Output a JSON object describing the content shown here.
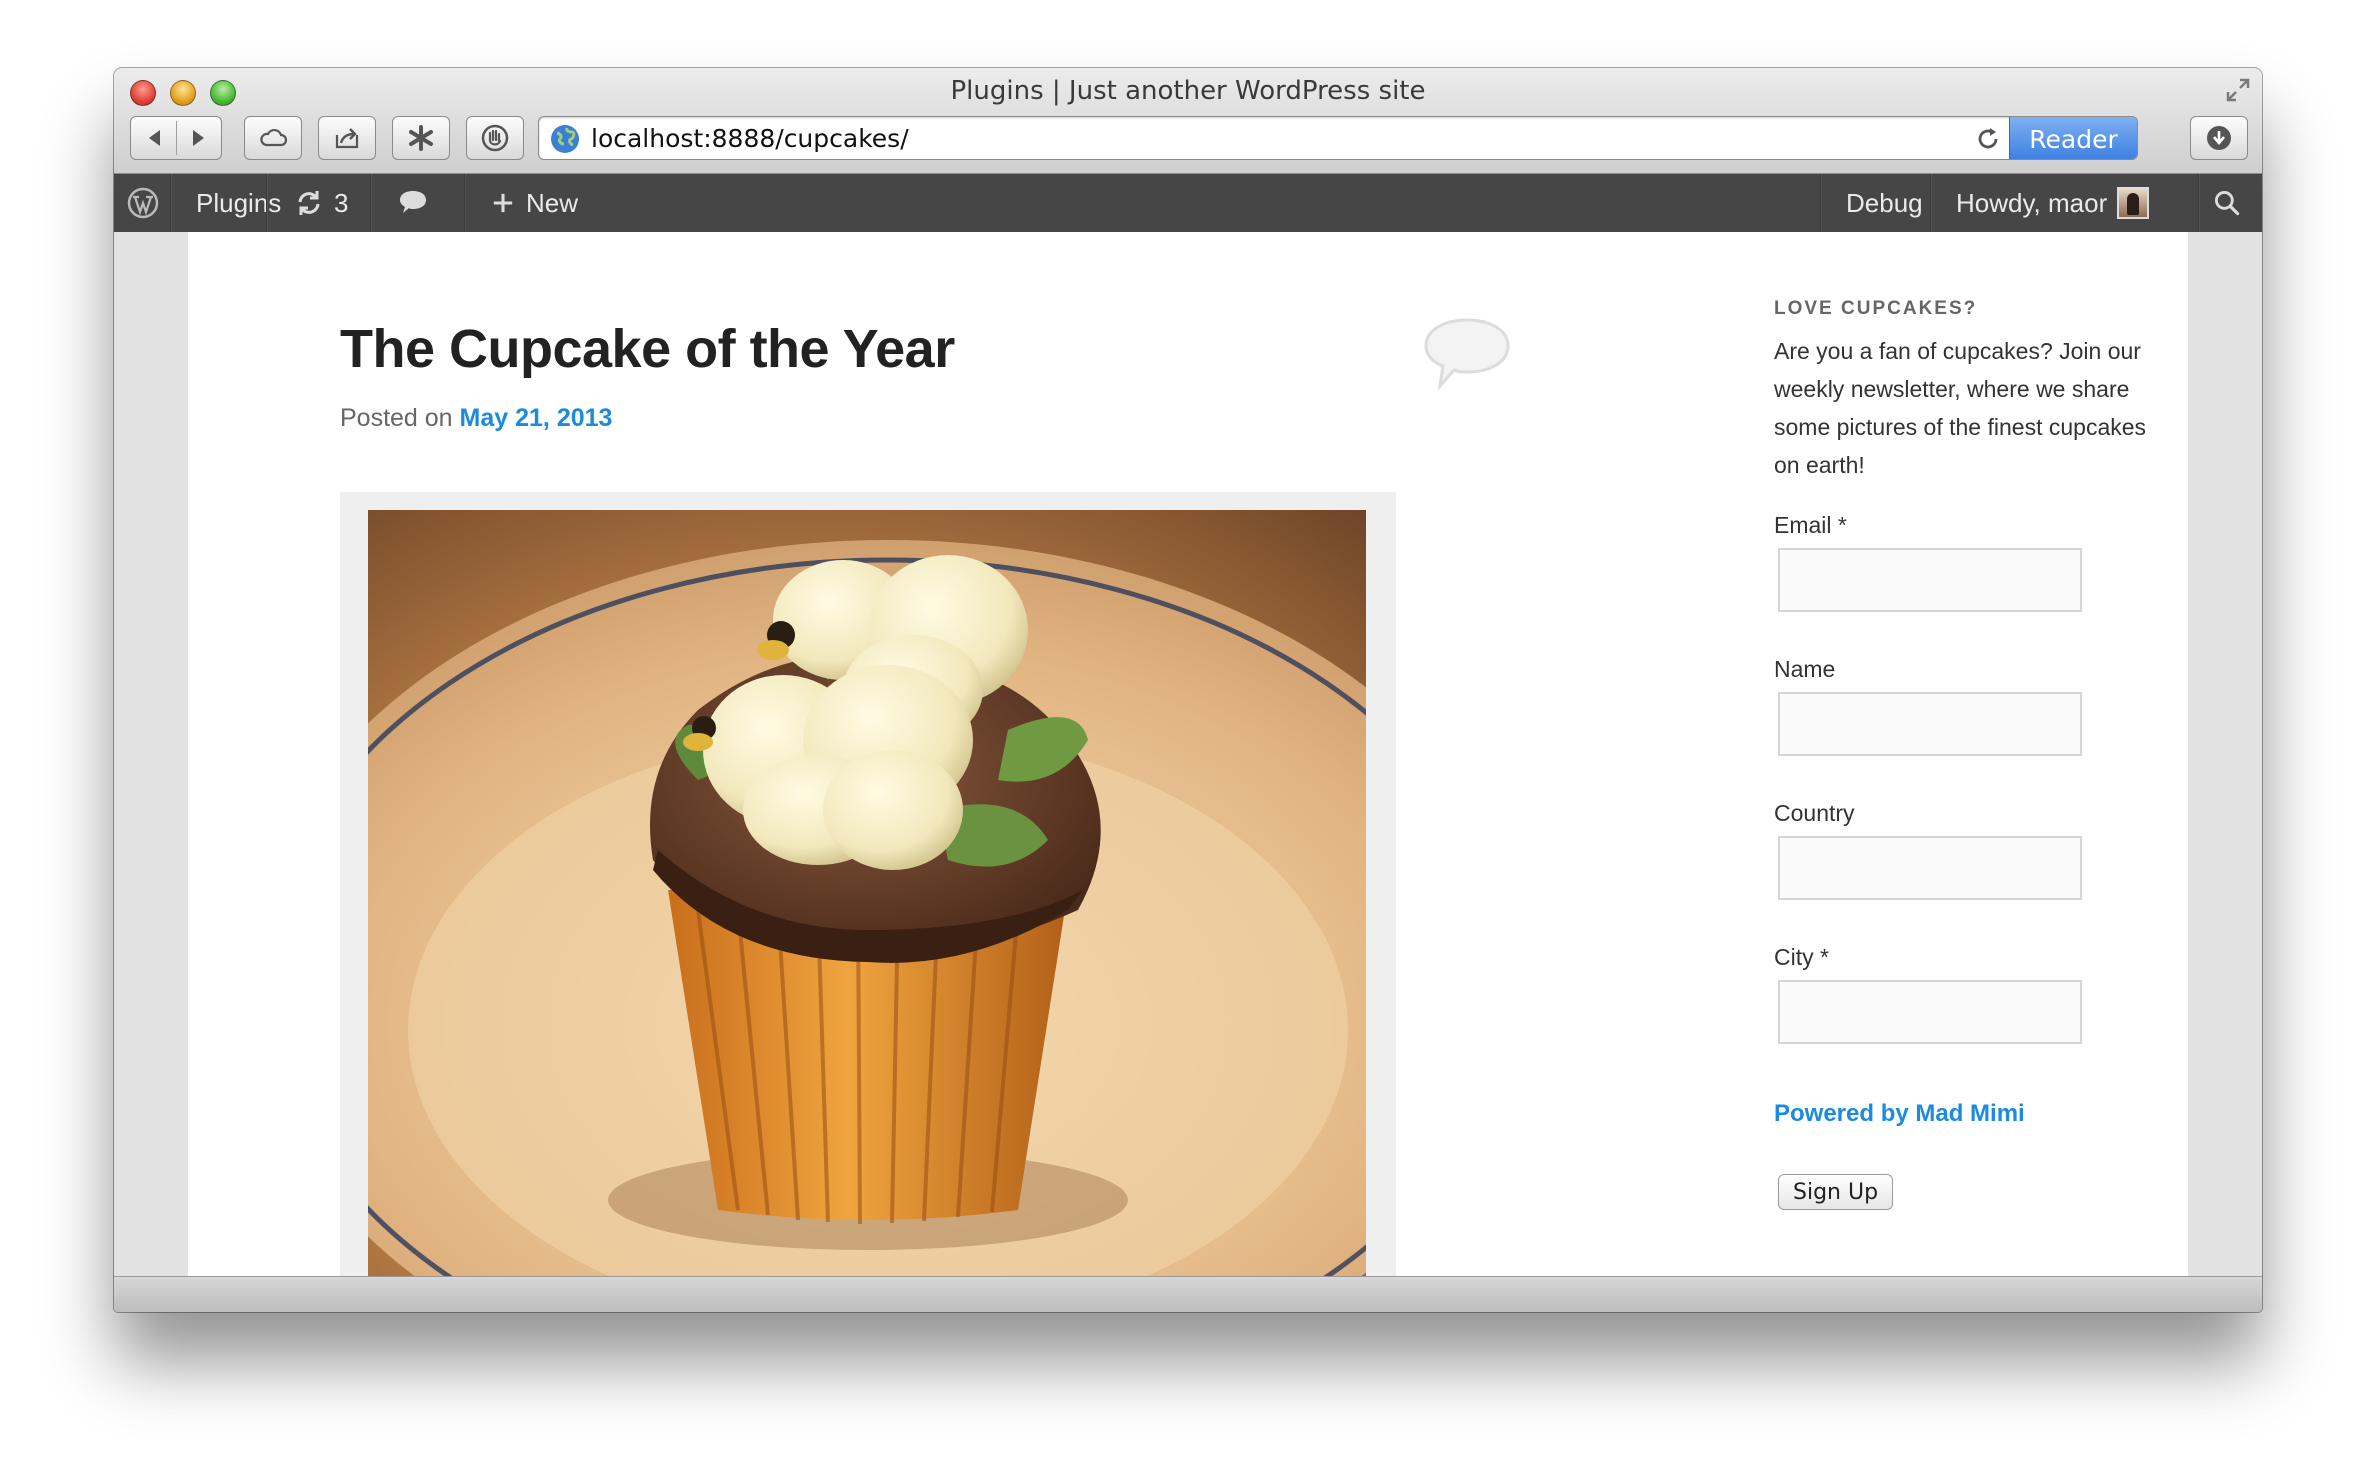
{
  "window": {
    "title": "Plugins | Just another WordPress site",
    "url": "localhost:8888/cupcakes/",
    "reader_label": "Reader"
  },
  "admin_bar": {
    "plugins_label": "Plugins",
    "updates_count": "3",
    "new_label": "New",
    "debug_label": "Debug",
    "howdy_label": "Howdy, maor"
  },
  "post": {
    "title": "The Cupcake of the Year",
    "posted_prefix": "Posted on",
    "date": "May 21, 2013"
  },
  "sidebar": {
    "widget_title": "LOVE CUPCAKES?",
    "description_lines": [
      "Are you a fan of cupcakes? Join our",
      "weekly newsletter, where we share",
      "some pictures of the finest cupcakes",
      "on earth!"
    ],
    "fields": [
      {
        "label": "Email *"
      },
      {
        "label": "Name"
      },
      {
        "label": "Country"
      },
      {
        "label": "City *"
      }
    ],
    "powered_by": "Powered by Mad Mimi",
    "signup_label": "Sign Up"
  },
  "colors": {
    "link": "#1b8be0",
    "admin_bar": "#464646",
    "reader": "#3c7fe0"
  }
}
